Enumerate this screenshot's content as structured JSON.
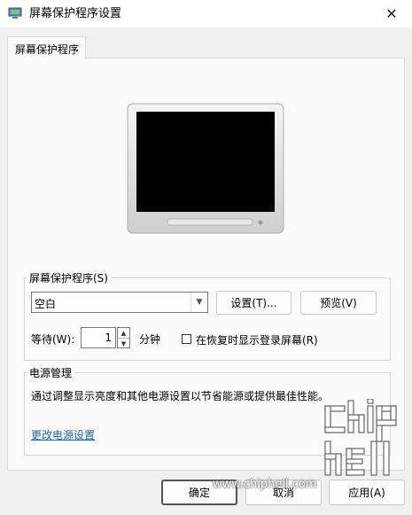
{
  "window": {
    "title": "屏幕保护程序设置",
    "close_glyph": "✕"
  },
  "tab": {
    "label": "屏幕保护程序"
  },
  "screensaver": {
    "group_label": "屏幕保护程序(S)",
    "selected": "空白",
    "settings_label": "设置(T)...",
    "preview_label": "预览(V)",
    "wait_label": "等待(W):",
    "wait_value": "1",
    "minutes_label": "分钟",
    "resume_checked": false,
    "resume_label": "在恢复时显示登录屏幕(R)"
  },
  "power": {
    "group_label": "电源管理",
    "description": "通过调整显示亮度和其他电源设置以节省能源或提供最佳性能。",
    "link": "更改电源设置"
  },
  "footer": {
    "ok_label": "确定",
    "cancel_label": "取消",
    "apply_label": "应用(A)"
  },
  "watermark": {
    "url": "www.chiphell.com",
    "logo_text": "chiphell"
  },
  "colors": {
    "link": "#1b66b5",
    "screen": "#000000",
    "panel": "#fafafa"
  }
}
